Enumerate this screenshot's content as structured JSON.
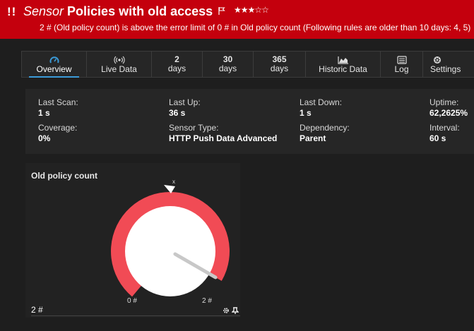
{
  "header": {
    "alert_mark": "!!",
    "sensor_word": "Sensor",
    "sensor_name": "Policies with old access",
    "priority_stars": "★★★☆☆",
    "message": "2 # (Old policy count) is above the error limit of 0 # in Old policy count (Following rules are older than 10 days: 4, 5)",
    "banner_color": "#c4000d"
  },
  "tabs": [
    {
      "label": "Overview",
      "icon": "overview-gauge-icon",
      "active": true
    },
    {
      "label": "Live Data",
      "icon": "live-signal-icon"
    },
    {
      "number": "2",
      "label": "days"
    },
    {
      "number": "30",
      "label": "days"
    },
    {
      "number": "365",
      "label": "days"
    },
    {
      "label": "Historic Data",
      "icon": "area-chart-icon"
    },
    {
      "label": "Log",
      "icon": "log-list-icon"
    },
    {
      "label": "Settings",
      "icon": "gear-icon"
    }
  ],
  "info": {
    "last_scan": {
      "label": "Last Scan:",
      "value": "1 s"
    },
    "last_up": {
      "label": "Last Up:",
      "value": "36 s"
    },
    "last_down": {
      "label": "Last Down:",
      "value": "1 s"
    },
    "uptime": {
      "label": "Uptime:",
      "value": "62,2625%"
    },
    "coverage": {
      "label": "Coverage:",
      "value": "0%"
    },
    "sensor_type": {
      "label": "Sensor Type:",
      "value": "HTTP Push Data Advanced"
    },
    "dependency": {
      "label": "Dependency:",
      "value": "Parent"
    },
    "interval": {
      "label": "Interval:",
      "value": "60 s"
    }
  },
  "channel": {
    "title": "Old policy count",
    "value_text": "2 #",
    "gauge_min_label": "0 #",
    "gauge_max_label": "2 #",
    "gauge_value": 2,
    "gauge_min": 0,
    "gauge_max": 2,
    "marker_label": "x",
    "error_color": "#f14b55",
    "tools": [
      "gear-icon",
      "pin-icon"
    ]
  }
}
